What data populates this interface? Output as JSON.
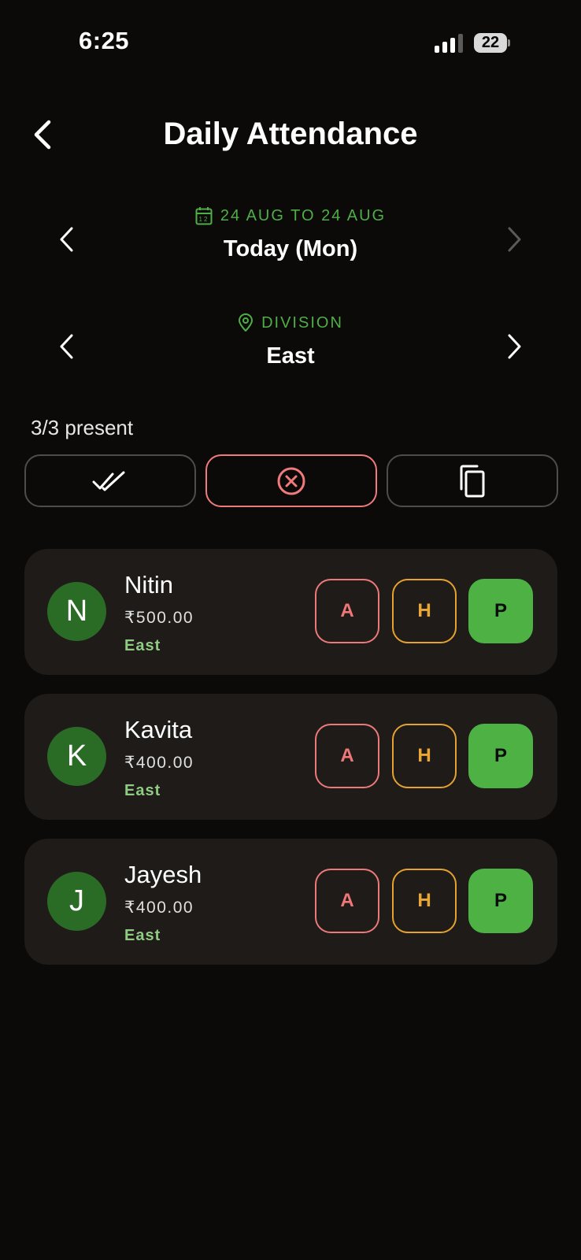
{
  "status_bar": {
    "time": "6:25",
    "battery": "22"
  },
  "header": {
    "title": "Daily Attendance"
  },
  "date_selector": {
    "range": "24 AUG TO 24 AUG",
    "label": "Today (Mon)"
  },
  "division_selector": {
    "kicker": "DIVISION",
    "value": "East"
  },
  "summary": {
    "present_text": "3/3 present"
  },
  "actions": [
    {
      "icon": "double-check-icon"
    },
    {
      "icon": "x-circle-icon",
      "color": "#ef7b7b"
    },
    {
      "icon": "copy-icon"
    }
  ],
  "attendance_labels": {
    "absent": "A",
    "half": "H",
    "present": "P"
  },
  "employees": [
    {
      "initial": "N",
      "name": "Nitin",
      "wage": "₹500.00",
      "division": "East",
      "status": "P"
    },
    {
      "initial": "K",
      "name": "Kavita",
      "wage": "₹400.00",
      "division": "East",
      "status": "P"
    },
    {
      "initial": "J",
      "name": "Jayesh",
      "wage": "₹400.00",
      "division": "East",
      "status": "P"
    }
  ],
  "colors": {
    "background": "#0b0a09",
    "card": "#1e1b19",
    "accent_green": "#4db243",
    "absent_red": "#ef7777",
    "half_orange": "#eba733",
    "avatar_green": "#2a6b25"
  }
}
